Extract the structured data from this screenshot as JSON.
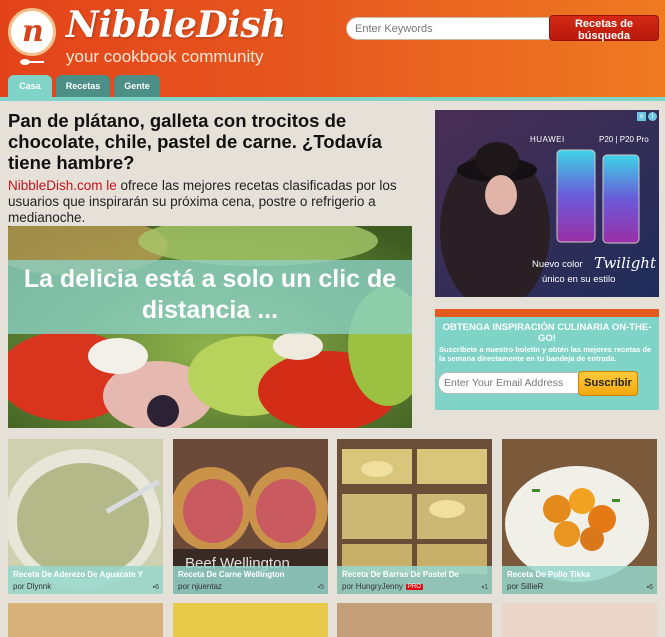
{
  "header": {
    "brand": "NibbleDish",
    "tagline": "your cookbook community",
    "logo_letter": "n",
    "search_placeholder": "Enter Keywords",
    "search_button": "Recetas de búsqueda",
    "tabs": [
      {
        "label": "Casa",
        "active": true
      },
      {
        "label": "Recetas",
        "active": false
      },
      {
        "label": "Gente",
        "active": false
      }
    ]
  },
  "hero": {
    "title": "Pan de plátano, galleta con trocitos de chocolate, chile, pastel de carne. ¿Todavía tiene hambre?",
    "desc_site": "NibbleDish.com le",
    "desc_rest": " ofrece las mejores recetas clasificadas por los usuarios que inspirarán su próxima cena, postre o refrigerio a medianoche.",
    "image_tagline": "La delicia está a solo un clic de distancia ..."
  },
  "ad": {
    "brand": "HUAWEI",
    "model": "P20 | P20 Pro",
    "line1": "Nuevo color",
    "twilight": "Twilight",
    "line2": "único en su estilo",
    "info": "i",
    "close": "x"
  },
  "newsletter": {
    "title": "OBTENGA INSPIRACIÓN CULINARIA ON-THE-GO!",
    "subtitle": "Suscríbete a nuestro boletín y obtén las mejores recetas de la semana directamente en tu bandeja de entrada.",
    "email_placeholder": "Enter Your Email Address",
    "button": "Suscribir"
  },
  "cards": [
    {
      "title": "Receta De Aderezo De Aguacate Y",
      "by": "por Dlynnk",
      "count": "6",
      "pro": ""
    },
    {
      "title": "Receta De Carne Wellington",
      "by": "por njuentaz",
      "count": "5",
      "pro": "",
      "watermark": "Beef Wellington"
    },
    {
      "title": "Receta De Barras De Pastel De",
      "by": "por HungryJenny",
      "count": "1",
      "pro": "PRO"
    },
    {
      "title": "Receta De Pollo Tikka",
      "by": "por SillieR",
      "count": "6",
      "pro": ""
    }
  ],
  "colors": {
    "header_orange": "#e6571f",
    "accent_teal": "#7fd3c7",
    "search_red": "#c81f10",
    "subscribe_yellow": "#f7b820"
  }
}
